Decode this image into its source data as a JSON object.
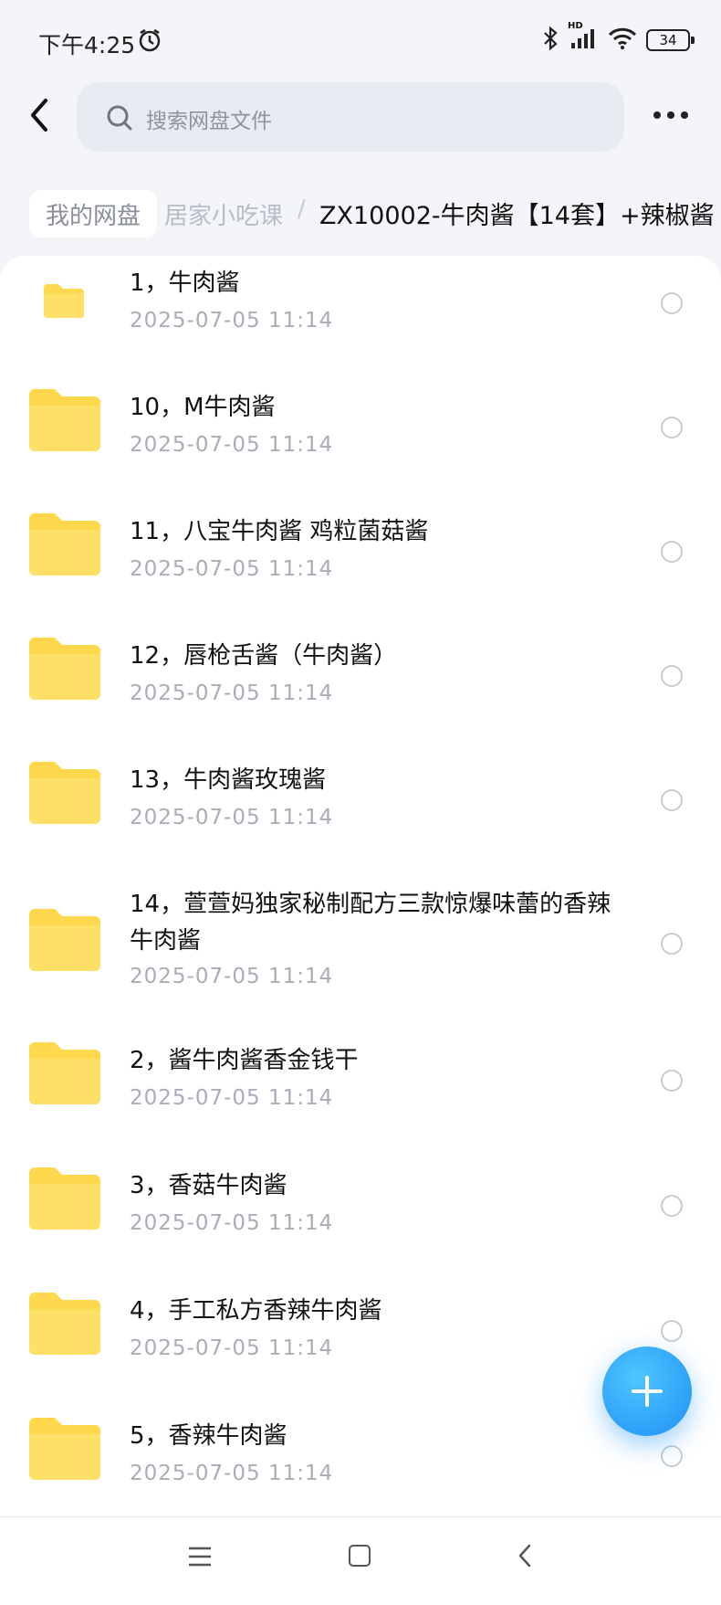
{
  "status_bar": {
    "time": "下午4:25",
    "network": "HD",
    "battery": "34"
  },
  "header": {
    "search_placeholder": "搜索网盘文件"
  },
  "breadcrumb": {
    "home": "我的网盘",
    "middle": "居家小吃课",
    "separator": "/",
    "current": "ZX10002-牛肉酱【14套】+辣椒酱"
  },
  "files": [
    {
      "name": "1，牛肉酱",
      "date": "2025-07-05  11:14"
    },
    {
      "name": "10，M牛肉酱",
      "date": "2025-07-05  11:14"
    },
    {
      "name": "11，八宝牛肉酱 鸡粒菌菇酱",
      "date": "2025-07-05  11:14"
    },
    {
      "name": "12，唇枪舌酱（牛肉酱）",
      "date": "2025-07-05  11:14"
    },
    {
      "name": "13，牛肉酱玫瑰酱",
      "date": "2025-07-05  11:14"
    },
    {
      "name": "14，萱萱妈独家秘制配方三款惊爆味蕾的香辣牛肉酱",
      "date": "2025-07-05  11:14"
    },
    {
      "name": "2，酱牛肉酱香金钱干",
      "date": "2025-07-05  11:14"
    },
    {
      "name": "3，香菇牛肉酱",
      "date": "2025-07-05  11:14"
    },
    {
      "name": "4，手工私方香辣牛肉酱",
      "date": "2025-07-05  11:14"
    },
    {
      "name": "5，香辣牛肉酱",
      "date": "2025-07-05  11:14"
    }
  ],
  "colors": {
    "folder": "#ffd84d",
    "accent": "#1f8ff5"
  }
}
